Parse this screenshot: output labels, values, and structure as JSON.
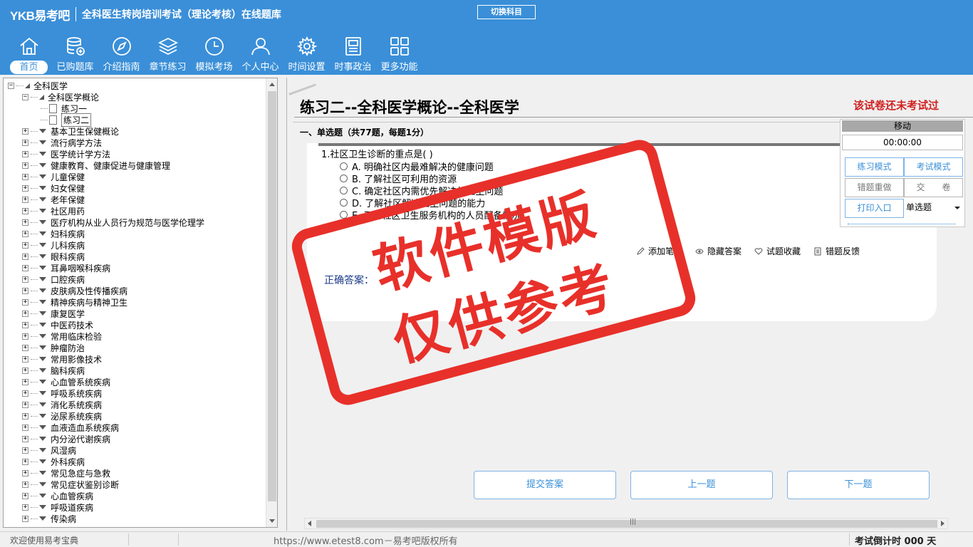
{
  "header": {
    "logo": "YKB易考吧",
    "title": "全科医生转岗培训考试（理论考核）在线题库",
    "switch_subject": "切换科目"
  },
  "nav": [
    {
      "label": "首页",
      "icon": "home-icon",
      "active": true
    },
    {
      "label": "已购题库",
      "icon": "database-icon"
    },
    {
      "label": "介绍指南",
      "icon": "compass-icon"
    },
    {
      "label": "章节练习",
      "icon": "layers-icon"
    },
    {
      "label": "模拟考场",
      "icon": "clock-icon"
    },
    {
      "label": "个人中心",
      "icon": "user-icon"
    },
    {
      "label": "时间设置",
      "icon": "gear-icon"
    },
    {
      "label": "时事政治",
      "icon": "news-icon"
    },
    {
      "label": "更多功能",
      "icon": "grid-icon"
    }
  ],
  "tree": {
    "root": "全科医学",
    "open_chapter": "全科医学概论",
    "open_items": [
      "练习一",
      "练习二"
    ],
    "chapters": [
      "基本卫生保健概论",
      "流行病学方法",
      "医学统计学方法",
      "健康教育、健康促进与健康管理",
      "儿童保健",
      "妇女保健",
      "老年保健",
      "社区用药",
      "医疗机构从业人员行为规范与医学伦理学",
      "妇科疾病",
      "儿科疾病",
      "眼科疾病",
      "耳鼻咽喉科疾病",
      "口腔疾病",
      "皮肤病及性传播疾病",
      "精神疾病与精神卫生",
      "康复医学",
      "中医药技术",
      "常用临床检验",
      "肿瘤防治",
      "常用影像技术",
      "脑科疾病",
      "心血管系统疾病",
      "呼吸系统疾病",
      "消化系统疾病",
      "泌尿系统疾病",
      "血液造血系统疾病",
      "内分泌代谢疾病",
      "风湿病",
      "外科疾病",
      "常见急症与急救",
      "常见症状鉴别诊断",
      "心血管疾病",
      "呼吸道疾病",
      "传染病"
    ]
  },
  "main": {
    "title": "练习二--全科医学概论--全科医学",
    "status": "该试卷还未考试过",
    "section": "一、单选题（共77题，每题1分）",
    "question": "1.社区卫生诊断的重点是( )",
    "options": [
      "A. 明确社区内最难解决的健康问题",
      "B. 了解社区可利用的资源",
      "C. 确定社区内需优先解决的卫生问题",
      "D. 了解社区解决卫生问题的能力",
      "E. 了解社区卫生服务机构的人员配备情况"
    ],
    "actions": [
      "添加笔记",
      "隐藏答案",
      "试题收藏",
      "错题反馈"
    ],
    "answer_label": "正确答案：",
    "buttons": {
      "submit": "提交答案",
      "prev": "上一题",
      "next": "下一题"
    }
  },
  "side": {
    "header": "移动",
    "timer": "00:00:00",
    "practice_mode": "练习模式",
    "exam_mode": "考试模式",
    "redo_wrong": "错题重做",
    "submit_paper": "交　　卷",
    "print": "打印入口",
    "type_select": "单选题"
  },
  "statusbar": {
    "welcome": "欢迎使用易考宝典",
    "site": "https://www.etest8.com－易考吧版权所有",
    "countdown": "考试倒计时 000 天"
  },
  "watermark": {
    "line1": "软件模版",
    "line2": "仅供参考"
  },
  "colors": {
    "header_bg": "#3a8fd8",
    "status_red": "#d02020",
    "stamp_red": "#e8302a",
    "accent": "#3a8fd8"
  }
}
